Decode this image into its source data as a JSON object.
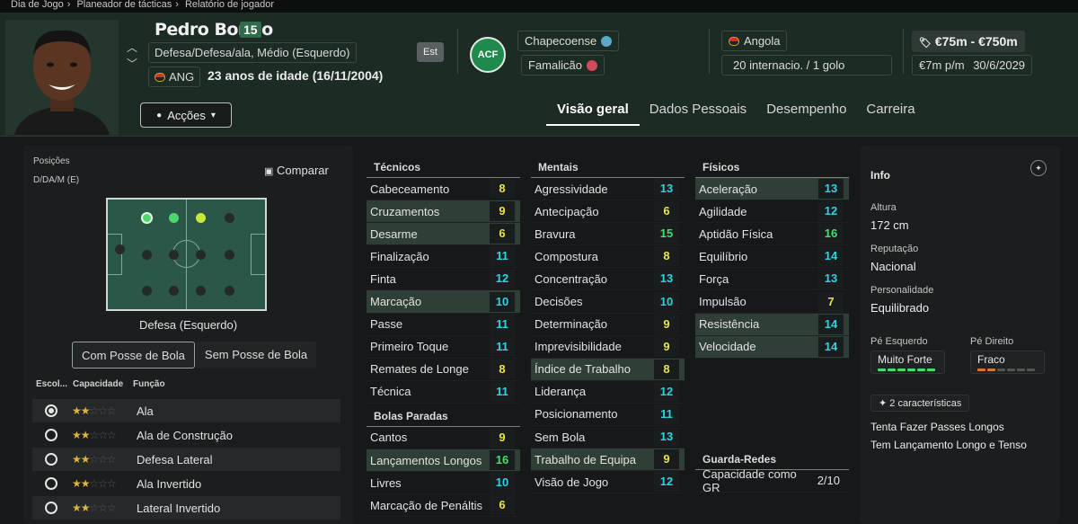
{
  "breadcrumb": [
    "Dia de Jogo",
    "Planeador de tácticas",
    "Relatório de jogador"
  ],
  "player": {
    "name": "Pedro Bondo",
    "number": "15",
    "positions": "Defesa/Defesa/ala, Médio (Esquerdo)",
    "nation_code": "ANG",
    "age": "23 anos de idade (16/11/2004)",
    "est_label": "Est",
    "club": "Chapecoense",
    "loan_club": "Famalicão",
    "club_logo_text": "ACF",
    "nation": "Angola",
    "caps": "20 internacio. / 1 golo",
    "value": "€75m - €750m",
    "wage": "€7m p/m",
    "contract": "30/6/2029"
  },
  "actions_label": "Acções",
  "tabs": [
    "Visão geral",
    "Dados Pessoais",
    "Desempenho",
    "Carreira"
  ],
  "positions_panel": {
    "label": "Posições",
    "value": "D/DA/M (E)",
    "compare": "Comparar",
    "pitch_caption": "Defesa (Esquerdo)",
    "toggle_on": "Com Posse de Bola",
    "toggle_off": "Sem Posse de Bola",
    "col_escol": "Escol...",
    "col_capacidade": "Capacidade",
    "col_funcao": "Função",
    "roles": [
      {
        "name": "Ala",
        "stars": 2,
        "selected": true
      },
      {
        "name": "Ala de Construção",
        "stars": 2,
        "selected": false
      },
      {
        "name": "Defesa Lateral",
        "stars": 2,
        "selected": false
      },
      {
        "name": "Ala Invertido",
        "stars": 2,
        "selected": false
      },
      {
        "name": "Lateral Invertido",
        "stars": 2,
        "selected": false
      }
    ]
  },
  "attributes": {
    "tecnicos_title": "Técnicos",
    "tecnicos": [
      {
        "n": "Cabeceamento",
        "v": 8,
        "hl": false
      },
      {
        "n": "Cruzamentos",
        "v": 9,
        "hl": true
      },
      {
        "n": "Desarme",
        "v": 6,
        "hl": true
      },
      {
        "n": "Finalização",
        "v": 11,
        "hl": false
      },
      {
        "n": "Finta",
        "v": 12,
        "hl": false
      },
      {
        "n": "Marcação",
        "v": 10,
        "hl": true
      },
      {
        "n": "Passe",
        "v": 11,
        "hl": false
      },
      {
        "n": "Primeiro Toque",
        "v": 11,
        "hl": false
      },
      {
        "n": "Remates de Longe",
        "v": 8,
        "hl": false
      },
      {
        "n": "Técnica",
        "v": 11,
        "hl": false
      }
    ],
    "bolas_title": "Bolas Paradas",
    "bolas": [
      {
        "n": "Cantos",
        "v": 9,
        "hl": false
      },
      {
        "n": "Lançamentos Longos",
        "v": 16,
        "hl": true
      },
      {
        "n": "Livres",
        "v": 10,
        "hl": false
      },
      {
        "n": "Marcação de Penáltis",
        "v": 6,
        "hl": false
      }
    ],
    "mentais_title": "Mentais",
    "mentais": [
      {
        "n": "Agressividade",
        "v": 13,
        "hl": false
      },
      {
        "n": "Antecipação",
        "v": 6,
        "hl": false
      },
      {
        "n": "Bravura",
        "v": 15,
        "hl": false
      },
      {
        "n": "Compostura",
        "v": 8,
        "hl": false
      },
      {
        "n": "Concentração",
        "v": 13,
        "hl": false
      },
      {
        "n": "Decisões",
        "v": 10,
        "hl": false
      },
      {
        "n": "Determinação",
        "v": 9,
        "hl": false
      },
      {
        "n": "Imprevisibilidade",
        "v": 9,
        "hl": false
      },
      {
        "n": "Índice de Trabalho",
        "v": 8,
        "hl": true
      },
      {
        "n": "Liderança",
        "v": 12,
        "hl": false
      },
      {
        "n": "Posicionamento",
        "v": 11,
        "hl": false
      },
      {
        "n": "Sem Bola",
        "v": 13,
        "hl": false
      },
      {
        "n": "Trabalho de Equipa",
        "v": 9,
        "hl": true
      },
      {
        "n": "Visão de Jogo",
        "v": 12,
        "hl": false
      }
    ],
    "fisicos_title": "Físicos",
    "fisicos": [
      {
        "n": "Aceleração",
        "v": 13,
        "hl": true
      },
      {
        "n": "Agilidade",
        "v": 12,
        "hl": false
      },
      {
        "n": "Aptidão Física",
        "v": 16,
        "hl": false
      },
      {
        "n": "Equilíbrio",
        "v": 14,
        "hl": false
      },
      {
        "n": "Força",
        "v": 13,
        "hl": false
      },
      {
        "n": "Impulsão",
        "v": 7,
        "hl": false
      },
      {
        "n": "Resistência",
        "v": 14,
        "hl": true
      },
      {
        "n": "Velocidade",
        "v": 14,
        "hl": true
      }
    ],
    "gr_title": "Guarda-Redes",
    "gr_label": "Capacidade como GR",
    "gr_value": "2/10"
  },
  "info": {
    "title": "Info",
    "altura_k": "Altura",
    "altura_v": "172 cm",
    "reput_k": "Reputação",
    "reput_v": "Nacional",
    "person_k": "Personalidade",
    "person_v": "Equilibrado",
    "pe_esq_k": "Pé Esquerdo",
    "pe_esq_v": "Muito Forte",
    "pe_dir_k": "Pé Direito",
    "pe_dir_v": "Fraco",
    "traits_label": "2 características",
    "traits": [
      "Tenta Fazer Passes Longos",
      "Tem Lançamento Longo e Tenso"
    ]
  },
  "colors": {
    "attr_high": "#41e06a",
    "attr_mid": "#2fd3e0",
    "attr_low": "#e8e34a",
    "header_bg": "#1c2b24",
    "pitch": "#2a5748"
  }
}
